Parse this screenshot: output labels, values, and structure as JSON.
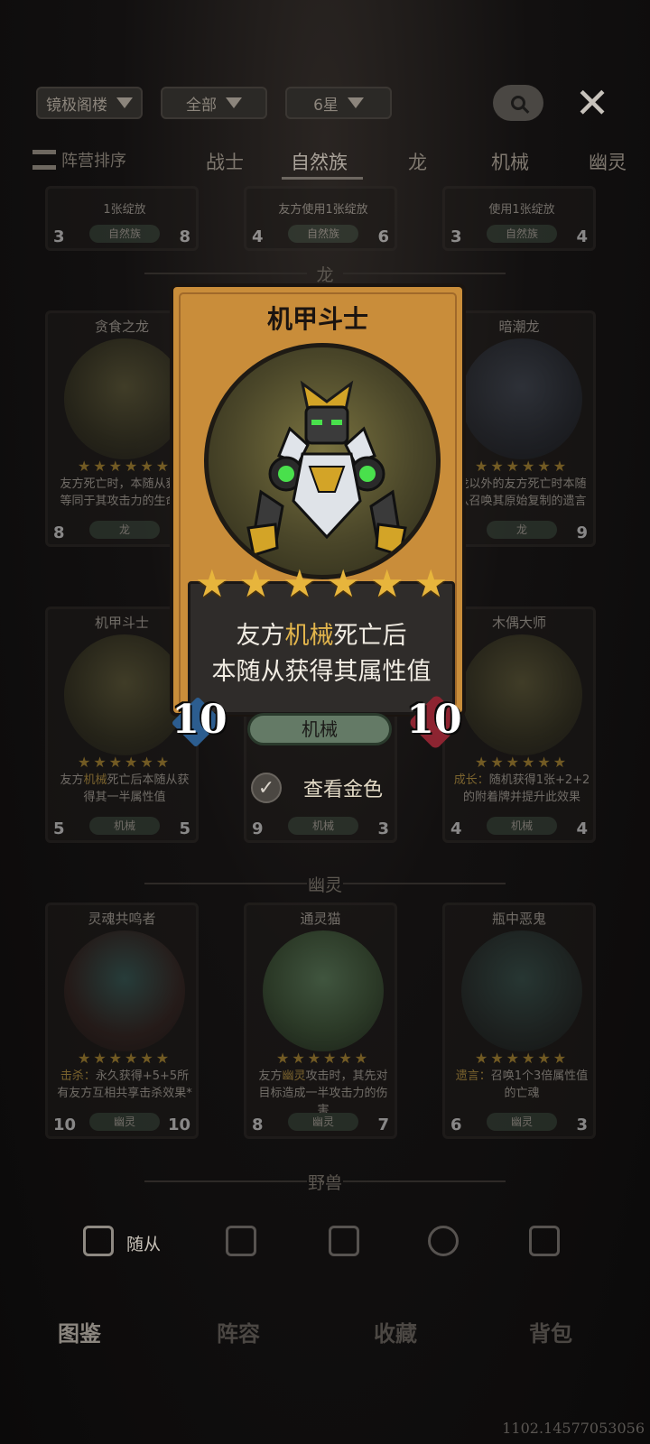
{
  "filters": {
    "floor": "镜极阁楼",
    "scope": "全部",
    "stars": "6星"
  },
  "tabs": {
    "sort_label": "阵营排序",
    "items": [
      "战士",
      "自然族",
      "龙",
      "机械",
      "幽灵"
    ],
    "active": "自然族"
  },
  "top_row": [
    {
      "desc": "1张绽放",
      "atk": "3",
      "hp": "8",
      "race": "自然族"
    },
    {
      "desc": "友方使用1张绽放",
      "atk": "4",
      "hp": "6",
      "race": "自然族"
    },
    {
      "desc": "使用1张绽放",
      "atk": "3",
      "hp": "4",
      "race": "自然族"
    }
  ],
  "sections": {
    "dragon": "龙",
    "ghost": "幽灵",
    "beast": "野兽"
  },
  "dragon_row": [
    {
      "title": "贪食之龙",
      "desc": "友方死亡时，本随从获得等同于其攻击力的生命值",
      "atk": "8",
      "hp": "",
      "race": "龙"
    },
    {
      "title": "暗潮龙",
      "desc": "龙以外的友方死亡时本随从召唤其原始复制的遗言",
      "atk": "",
      "hp": "9",
      "race": "龙"
    }
  ],
  "mech_row": [
    {
      "title": "机甲斗士",
      "desc_pre": "友方",
      "desc_hl": "机械",
      "desc_post": "死亡后本随从获得其一半属性值",
      "atk": "5",
      "hp": "5",
      "race": "机械"
    },
    {
      "title": "",
      "atk": "9",
      "hp": "3",
      "race": "机械"
    },
    {
      "title": "木偶大师",
      "desc_hl": "成长：",
      "desc_post": "随机获得1张+2+2的附着牌并提升此效果",
      "atk": "4",
      "hp": "4",
      "race": "机械"
    }
  ],
  "ghost_row": [
    {
      "title": "灵魂共鸣者",
      "desc_hl": "击杀：",
      "desc_post": "永久获得+5+5所有友方互相共享击杀效果*",
      "atk": "10",
      "hp": "10",
      "race": "幽灵"
    },
    {
      "title": "通灵猫",
      "desc_pre": "友方",
      "desc_hl": "幽灵",
      "desc_post": "攻击时，其先对目标造成一半攻击力的伤害",
      "atk": "8",
      "hp": "7",
      "race": "幽灵"
    },
    {
      "title": "瓶中恶鬼",
      "desc_hl": "遗言：",
      "desc_post": "召唤1个3倍属性值的亡魂",
      "atk": "6",
      "hp": "3",
      "race": "幽灵"
    }
  ],
  "feature": {
    "title": "机甲斗士",
    "stars": 6,
    "desc_line1_pre": "友方",
    "desc_line1_hl": "机械",
    "desc_line1_post": "死亡后",
    "desc_line2": "本随从获得其属性值",
    "atk": "10",
    "hp": "10",
    "race": "机械"
  },
  "gold_toggle": {
    "label": "查看金色",
    "checked": true
  },
  "subtabs": {
    "active_label": "随从"
  },
  "mainnav": [
    "图鉴",
    "阵容",
    "收藏",
    "背包"
  ],
  "version": "1102.14577053056",
  "colors": {
    "gold_frame": "#c98d3a",
    "highlight": "#e2b54c",
    "atk": "#2c5d8f",
    "hp": "#8d2431"
  }
}
